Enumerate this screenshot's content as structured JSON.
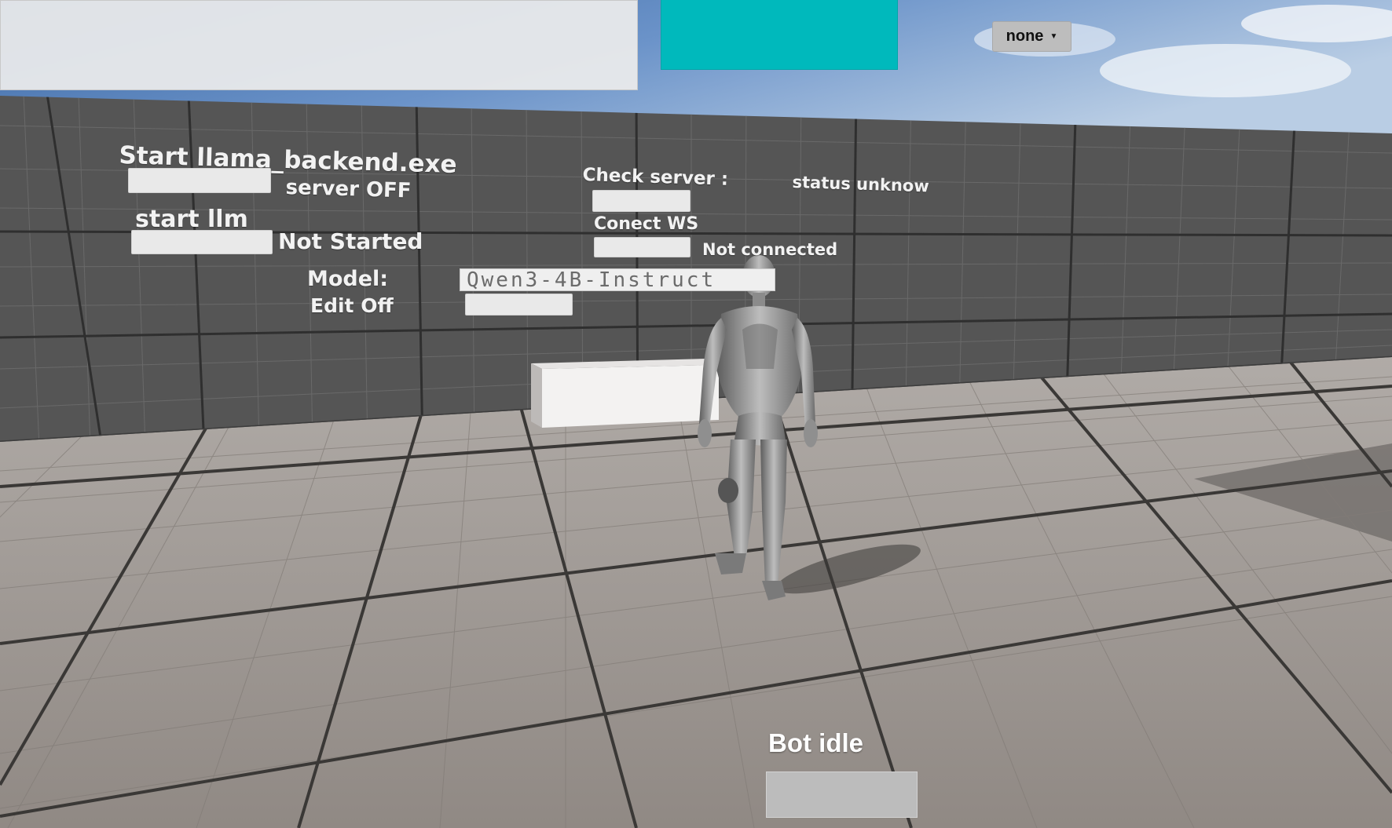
{
  "top_dropdown": {
    "value": "none"
  },
  "wall": {
    "start_backend_label": "Start llama_backend.exe",
    "server_status": "server OFF",
    "start_llm_label": "start llm",
    "llm_status": "Not Started",
    "check_server_label": "Check server :",
    "check_server_status": "status unknow",
    "connect_ws_label": "Conect WS",
    "ws_status": "Not connected",
    "model_label": "Model:",
    "model_value": "Qwen3-4B-Instruct",
    "edit_label": "Edit Off"
  },
  "bot": {
    "status": "Bot idle"
  },
  "colors": {
    "teal_panel": "#00b9bc",
    "sky": "#5e86c0",
    "wall": "#535353",
    "floor": "#a29c97"
  }
}
